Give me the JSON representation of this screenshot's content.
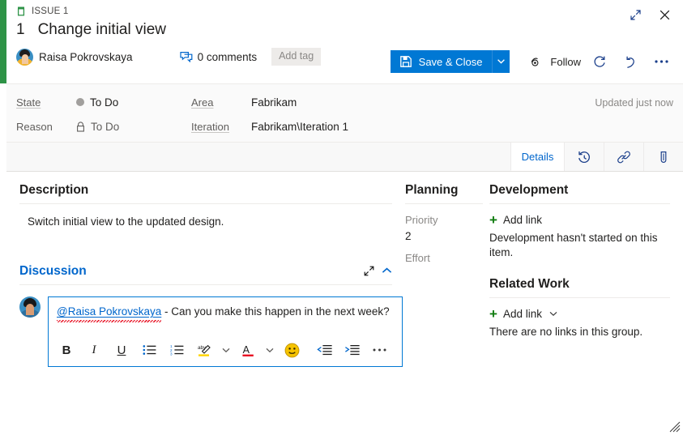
{
  "window": {
    "expand_icon": "expand-diagonal-icon",
    "close_icon": "close-icon"
  },
  "header": {
    "type_icon": "issue-icon",
    "type_label": "ISSUE 1",
    "work_item_id": "1",
    "title": "Change initial view",
    "assignee": "Raisa Pokrovskaya",
    "comments_label": "0 comments",
    "comments_icon": "comment-icon",
    "add_tag_label": "Add tag"
  },
  "toolbar": {
    "save_close_label": "Save & Close",
    "save_icon": "save-icon",
    "split_icon": "chevron-down-icon",
    "follow_label": "Follow",
    "follow_icon": "eye-icon",
    "refresh_icon": "refresh-icon",
    "revert_icon": "undo-icon",
    "more_icon": "ellipsis-icon",
    "accent_color": "#0078d4"
  },
  "fields": {
    "state_label": "State",
    "state_value": "To Do",
    "state_dot_color": "#a19f9d",
    "reason_label": "Reason",
    "reason_value": "To Do",
    "reason_icon": "lock-icon",
    "area_label": "Area",
    "area_value": "Fabrikam",
    "iteration_label": "Iteration",
    "iteration_value": "Fabrikam\\Iteration 1",
    "updated_text": "Updated just now"
  },
  "tabs": [
    {
      "label": "Details",
      "icon": "",
      "active": true
    },
    {
      "label": "",
      "icon": "history-icon",
      "active": false
    },
    {
      "label": "",
      "icon": "link-icon",
      "active": false
    },
    {
      "label": "",
      "icon": "attachment-icon",
      "active": false
    }
  ],
  "description": {
    "heading": "Description",
    "text": "Switch initial view to the updated design."
  },
  "discussion": {
    "heading": "Discussion",
    "expand_icon": "expand-diagonal-icon",
    "collapse_icon": "chevron-up-icon",
    "mention": "@Raisa Pokrovskaya",
    "comment_text": " - Can you make this happen in the next week?",
    "toolbar": [
      {
        "name": "bold-icon",
        "glyph": "B"
      },
      {
        "name": "italic-icon",
        "glyph": "I"
      },
      {
        "name": "underline-icon",
        "glyph": "U"
      },
      {
        "name": "bulleted-list-icon",
        "glyph": ""
      },
      {
        "name": "numbered-list-icon",
        "glyph": ""
      },
      {
        "name": "highlight-icon",
        "glyph": ""
      },
      {
        "name": "font-color-icon",
        "glyph": ""
      },
      {
        "name": "emoji-icon",
        "glyph": ""
      },
      {
        "name": "decrease-indent-icon",
        "glyph": ""
      },
      {
        "name": "increase-indent-icon",
        "glyph": ""
      },
      {
        "name": "more-options-icon",
        "glyph": ""
      }
    ]
  },
  "planning": {
    "heading": "Planning",
    "priority_label": "Priority",
    "priority_value": "2",
    "effort_label": "Effort",
    "effort_value": ""
  },
  "development": {
    "heading": "Development",
    "add_link_label": "Add link",
    "empty_text": "Development hasn't started on this item."
  },
  "related_work": {
    "heading": "Related Work",
    "add_link_label": "Add link",
    "chevron_icon": "chevron-down-icon",
    "empty_text": "There are no links in this group."
  }
}
